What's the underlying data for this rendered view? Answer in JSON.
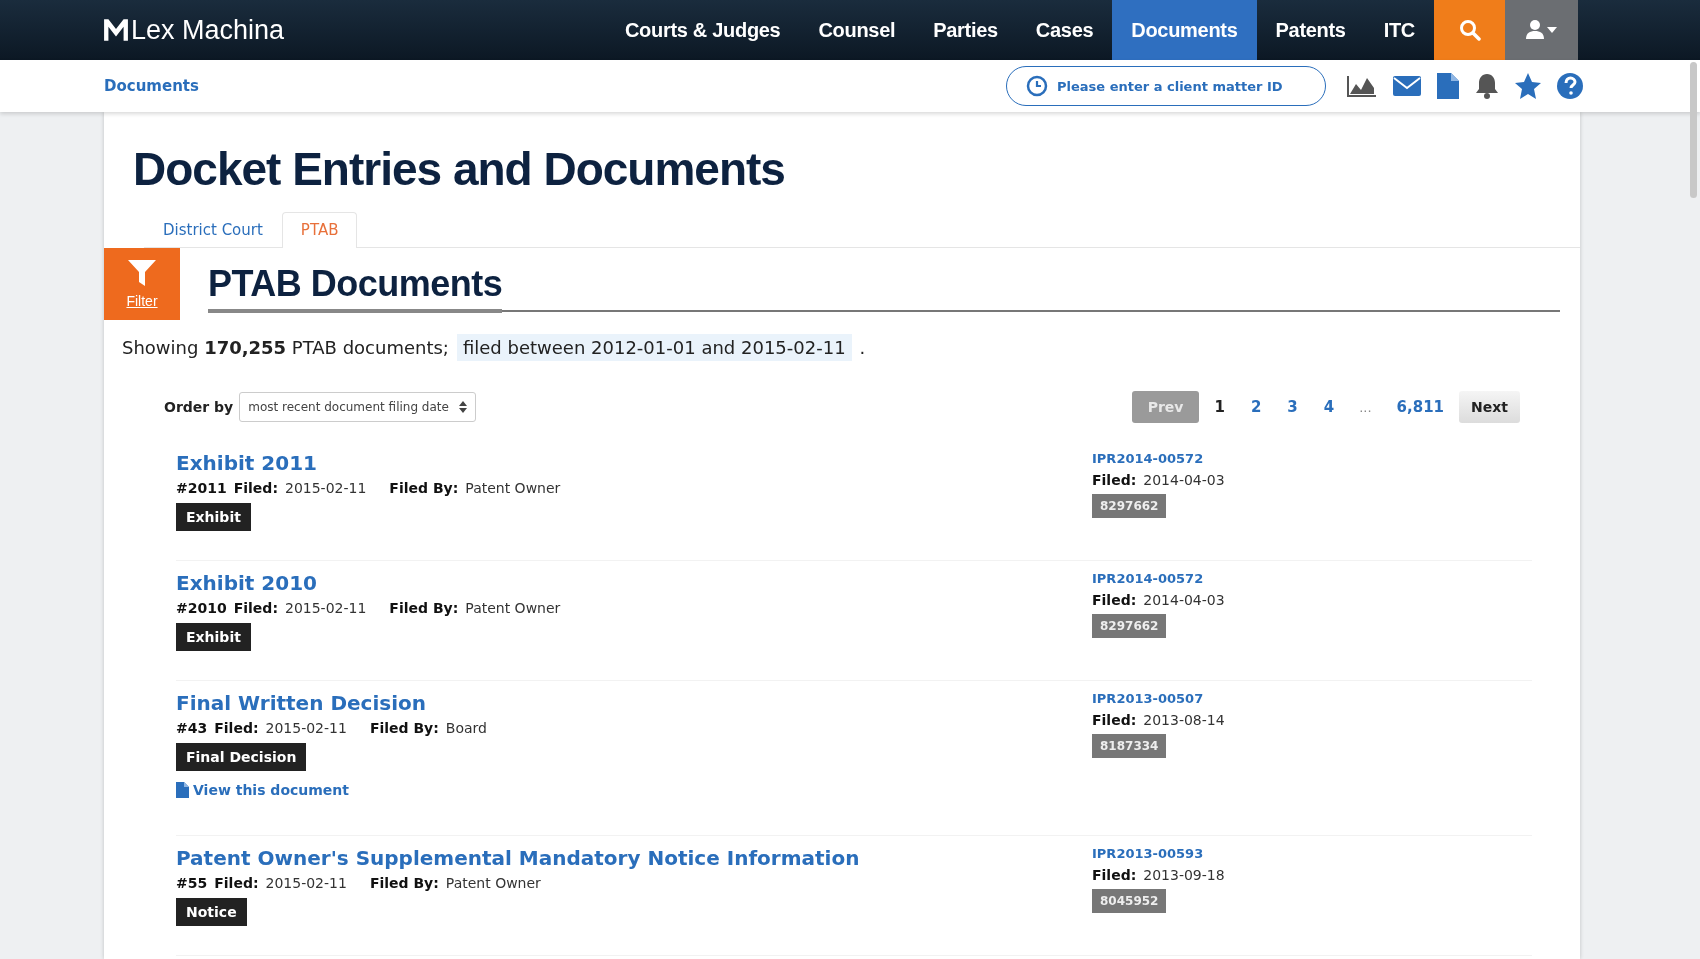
{
  "header": {
    "logo": "Lex Machina",
    "nav": [
      {
        "label": "Courts & Judges",
        "selected": false
      },
      {
        "label": "Counsel",
        "selected": false
      },
      {
        "label": "Parties",
        "selected": false
      },
      {
        "label": "Cases",
        "selected": false
      },
      {
        "label": "Documents",
        "selected": true
      },
      {
        "label": "Patents",
        "selected": false
      },
      {
        "label": "ITC",
        "selected": false
      }
    ]
  },
  "subbar": {
    "breadcrumb": "Documents",
    "client_matter": {
      "placeholder": "Please enter a client matter ID"
    }
  },
  "page": {
    "title": "Docket Entries and Documents",
    "tabs": [
      {
        "label": "District Court",
        "selected": false
      },
      {
        "label": "PTAB",
        "selected": true
      }
    ],
    "filter": {
      "label": "Filter"
    },
    "section_title": "PTAB Documents",
    "summary": {
      "text": "Showing **170,255** PTAB documents;",
      "filter_chip": "filed between 2012-01-01 and 2015-02-11",
      "end": "."
    },
    "order_by": {
      "label": "Order by",
      "value": "most recent document filing date"
    },
    "pagination": [
      {
        "kind": "prev",
        "label": "Prev",
        "disabled": true
      },
      {
        "kind": "page",
        "label": "1",
        "selected": true
      },
      {
        "kind": "page",
        "label": "2",
        "selected": false
      },
      {
        "kind": "page",
        "label": "3",
        "selected": false
      },
      {
        "kind": "page",
        "label": "4",
        "selected": false
      },
      {
        "kind": "gap",
        "label": "..."
      },
      {
        "kind": "page",
        "label": "6,811",
        "selected": false
      },
      {
        "kind": "next",
        "label": "Next",
        "disabled": false
      }
    ],
    "entries": [
      {
        "title": "Exhibit 2011",
        "number": "#2011",
        "filed_label": "Filed:",
        "filed": "2015-02-11",
        "filed_by_label": "Filed By:",
        "filed_by": "Patent Owner",
        "tag": "Exhibit",
        "case": "IPR2014-00572",
        "case_filed_label": "Filed:",
        "case_filed": "2014-04-03",
        "patent": "8297662"
      },
      {
        "title": "Exhibit 2010",
        "number": "#2010",
        "filed_label": "Filed:",
        "filed": "2015-02-11",
        "filed_by_label": "Filed By:",
        "filed_by": "Patent Owner",
        "tag": "Exhibit",
        "case": "IPR2014-00572",
        "case_filed_label": "Filed:",
        "case_filed": "2014-04-03",
        "patent": "8297662"
      },
      {
        "title": "Final Written Decision",
        "number": "#43",
        "filed_label": "Filed:",
        "filed": "2015-02-11",
        "filed_by_label": "Filed By:",
        "filed_by": "Board",
        "tag": "Final Decision",
        "link": "View this document",
        "case": "IPR2013-00507",
        "case_filed_label": "Filed:",
        "case_filed": "2013-08-14",
        "patent": "8187334"
      },
      {
        "title": "Patent Owner's Supplemental Mandatory Notice Information",
        "number": "#55",
        "filed_label": "Filed:",
        "filed": "2015-02-11",
        "filed_by_label": "Filed By:",
        "filed_by": "Patent Owner",
        "tag": "Notice",
        "case": "IPR2013-00593",
        "case_filed_label": "Filed:",
        "case_filed": "2013-09-18",
        "patent": "8045952"
      }
    ]
  }
}
